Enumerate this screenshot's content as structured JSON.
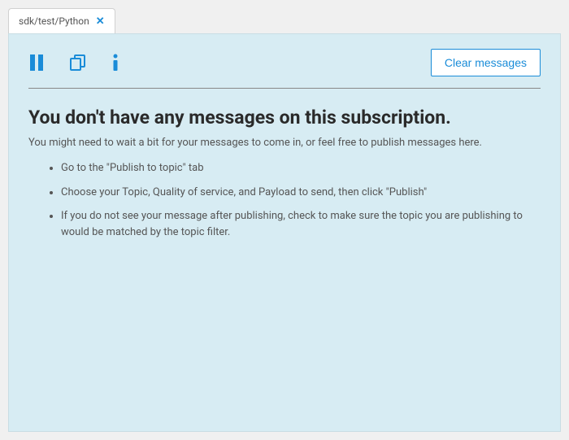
{
  "tab": {
    "label": "sdk/test/Python"
  },
  "toolbar": {
    "clear_label": "Clear messages"
  },
  "empty_state": {
    "headline": "You don't have any messages on this subscription.",
    "sub_text": "You might need to wait a bit for your messages to come in, or feel free to publish messages here.",
    "instructions": [
      "Go to the \"Publish to topic\" tab",
      "Choose your Topic, Quality of service, and Payload to send, then click \"Publish\"",
      "If you do not see your message after publishing, check to make sure the topic you are publishing to would be matched by the topic filter."
    ]
  }
}
